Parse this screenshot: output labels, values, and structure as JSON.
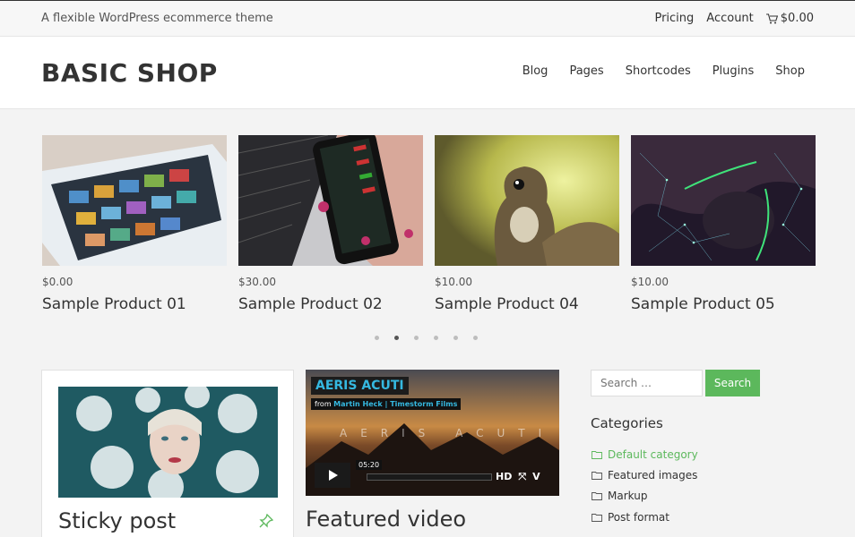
{
  "topbar": {
    "tagline": "A flexible WordPress ecommerce theme",
    "links": [
      "Pricing",
      "Account"
    ],
    "cart_total": "$0.00"
  },
  "header": {
    "logo": "BASIC SHOP",
    "nav": [
      "Blog",
      "Pages",
      "Shortcodes",
      "Plugins",
      "Shop"
    ]
  },
  "products": [
    {
      "price": "$0.00",
      "name": "Sample Product 01"
    },
    {
      "price": "$30.00",
      "name": "Sample Product 02"
    },
    {
      "price": "$10.00",
      "name": "Sample Product 04"
    },
    {
      "price": "$10.00",
      "name": "Sample Product 05"
    }
  ],
  "carousel": {
    "page_count": 6,
    "active_index": 1
  },
  "posts": {
    "sticky_title": "Sticky post",
    "video_title": "Featured video"
  },
  "video": {
    "title": "AERIS ACUTI",
    "from_label": "from",
    "author": "Martin Heck | Timestorm Films",
    "watermark": "AERIS ACUTI",
    "duration": "05:20",
    "controls": [
      "HD",
      "⤧",
      "V"
    ]
  },
  "sidebar": {
    "search_placeholder": "Search …",
    "search_button": "Search",
    "categories_heading": "Categories",
    "categories": [
      "Default category",
      "Featured images",
      "Markup",
      "Post format"
    ],
    "active_category": 0
  },
  "colors": {
    "accent": "#5cb85c",
    "video_title": "#35b8e0"
  }
}
